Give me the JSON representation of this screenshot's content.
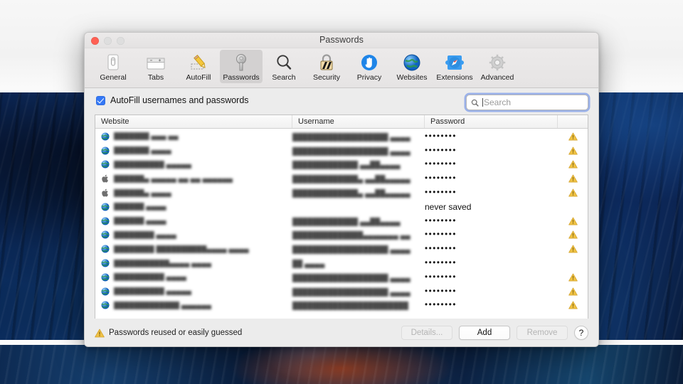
{
  "window": {
    "title": "Passwords",
    "traffic_lights": [
      "close",
      "minimize",
      "zoom"
    ]
  },
  "toolbar": {
    "items": [
      {
        "label": "General",
        "icon": "general-icon",
        "selected": false
      },
      {
        "label": "Tabs",
        "icon": "tabs-icon",
        "selected": false
      },
      {
        "label": "AutoFill",
        "icon": "autofill-icon",
        "selected": false
      },
      {
        "label": "Passwords",
        "icon": "passwords-key-icon",
        "selected": true
      },
      {
        "label": "Search",
        "icon": "magnifier-icon",
        "selected": false
      },
      {
        "label": "Security",
        "icon": "lock-icon",
        "selected": false
      },
      {
        "label": "Privacy",
        "icon": "hand-icon",
        "selected": false
      },
      {
        "label": "Websites",
        "icon": "globe-icon",
        "selected": false
      },
      {
        "label": "Extensions",
        "icon": "extensions-puzzle-icon",
        "selected": false
      },
      {
        "label": "Advanced",
        "icon": "gear-icon",
        "selected": false
      }
    ]
  },
  "autofill": {
    "label": "AutoFill usernames and passwords",
    "checked": true
  },
  "search": {
    "placeholder": "Search",
    "value": "",
    "focused": true
  },
  "table": {
    "columns": [
      "Website",
      "Username",
      "Password",
      ""
    ],
    "rows": [
      {
        "icon": "globe-icon",
        "website": "███████  ▄▄▄  ▄▄",
        "username": "███████████████████   ▄▄▄▄",
        "password": "••••••••",
        "warning": true
      },
      {
        "icon": "globe-icon",
        "website": "███████  ▄▄▄▄",
        "username": "███████████████████   ▄▄▄▄",
        "password": "••••••••",
        "warning": true
      },
      {
        "icon": "globe-icon",
        "website": "██████████   ▄▄▄▄▄",
        "username": "█████████████  ▄▄██▄▄▄▄",
        "password": "••••••••",
        "warning": true
      },
      {
        "icon": "apple-icon",
        "website": "██████▄  ▄▄▄▄▄  ▄▄ ▄▄   ▄▄▄▄▄▄",
        "username": "█████████████▄  ▄▄██▄▄▄▄▄",
        "password": "••••••••",
        "warning": true
      },
      {
        "icon": "apple-icon",
        "website": "██████▄  ▄▄▄▄",
        "username": "█████████████▄  ▄▄██▄▄▄▄▄",
        "password": "••••••••",
        "warning": true
      },
      {
        "icon": "globe-icon",
        "website": "██████  ▄▄▄▄",
        "username": "",
        "password": "never saved",
        "warning": false
      },
      {
        "icon": "globe-icon",
        "website": "██████  ▄▄▄▄",
        "username": "█████████████  ▄▄██▄▄▄▄",
        "password": "••••••••",
        "warning": true
      },
      {
        "icon": "globe-icon",
        "website": "████████  ▄▄▄▄",
        "username": "██████████████▄▄▄▄▄▄▄  ▄▄",
        "password": "••••••••",
        "warning": true
      },
      {
        "icon": "globe-icon",
        "website": "████████  ██████████▄▄▄▄   ▄▄▄▄",
        "username": "███████████████████   ▄▄▄▄",
        "password": "••••••••",
        "warning": true
      },
      {
        "icon": "globe-icon",
        "website": "███████████▄▄▄▄   ▄▄▄▄",
        "username": "██  ▄▄▄▄",
        "password": "••••••••",
        "warning": false
      },
      {
        "icon": "globe-icon",
        "website": "██████████   ▄▄▄▄",
        "username": "███████████████████   ▄▄▄▄",
        "password": "••••••••",
        "warning": true
      },
      {
        "icon": "globe-icon",
        "website": "██████████   ▄▄▄▄▄",
        "username": "███████████████████   ▄▄▄▄",
        "password": "••••••••",
        "warning": true
      },
      {
        "icon": "globe-icon",
        "website": "█████████████  ▄▄▄▄▄▄",
        "username": "███████████████████████",
        "password": "••••••••",
        "warning": true
      }
    ]
  },
  "statusbar": {
    "warning_icon": "warning-triangle-icon",
    "message": "Passwords reused or easily guessed",
    "buttons": [
      {
        "label": "Details...",
        "name": "details-button",
        "disabled": true
      },
      {
        "label": "Add",
        "name": "add-button",
        "disabled": false
      },
      {
        "label": "Remove",
        "name": "remove-button",
        "disabled": true
      },
      {
        "label": "?",
        "name": "help-button",
        "disabled": false
      }
    ]
  },
  "colors": {
    "accent": "#3478f6",
    "warning": "#e8b23a",
    "close_button": "#ff6054",
    "selected_toolbar": "#d3d1d1"
  }
}
